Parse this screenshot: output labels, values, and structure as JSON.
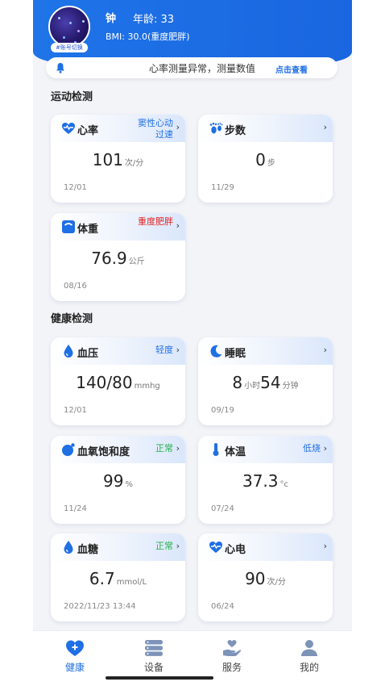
{
  "user": {
    "name": "钟",
    "age_label": "年龄: 33",
    "bmi_label": "BMI: 30.0(重度肥胖)",
    "switch_label": "#账号切换"
  },
  "notice": {
    "text": "心率测量异常，测量数值",
    "link": "点击查看"
  },
  "sections": {
    "sport_title": "运动检测",
    "health_title": "健康检测"
  },
  "cards": {
    "heart_rate": {
      "title": "心率",
      "status": "窦性心动过速",
      "value": "101",
      "unit": "次/分",
      "date": "12/01"
    },
    "steps": {
      "title": "步数",
      "status": "",
      "value": "0",
      "unit": "步",
      "date": "11/29"
    },
    "weight": {
      "title": "体重",
      "status": "重度肥胖",
      "value": "76.9",
      "unit": "公斤",
      "date": "08/16"
    },
    "blood_pressure": {
      "title": "血压",
      "status": "轻度",
      "value": "140/80",
      "unit": "mmhg",
      "date": "12/01"
    },
    "sleep": {
      "title": "睡眠",
      "status": "",
      "hours": "8",
      "hours_unit": "小时",
      "minutes": "54",
      "minutes_unit": "分钟",
      "date": "09/19"
    },
    "spo2": {
      "title": "血氧饱和度",
      "status": "正常",
      "value": "99",
      "unit": "%",
      "date": "11/24"
    },
    "temperature": {
      "title": "体温",
      "status": "低烧",
      "value": "37.3",
      "unit": "°c",
      "date": "07/24"
    },
    "glucose": {
      "title": "血糖",
      "status": "正常",
      "value": "6.7",
      "unit": "mmol/L",
      "date": "2022/11/23 13:44"
    },
    "ecg": {
      "title": "心电",
      "status": "",
      "value": "90",
      "unit": "次/分",
      "date": "06/24"
    }
  },
  "arrow": "›",
  "tabs": [
    {
      "label": "健康",
      "icon": "heart-icon",
      "active": true
    },
    {
      "label": "设备",
      "icon": "device-icon",
      "active": false
    },
    {
      "label": "服务",
      "icon": "service-icon",
      "active": false
    },
    {
      "label": "我的",
      "icon": "profile-icon",
      "active": false
    }
  ],
  "colors": {
    "primary": "#1f6fe5",
    "warning_red": "#e02323",
    "normal_green": "#23b04a"
  }
}
